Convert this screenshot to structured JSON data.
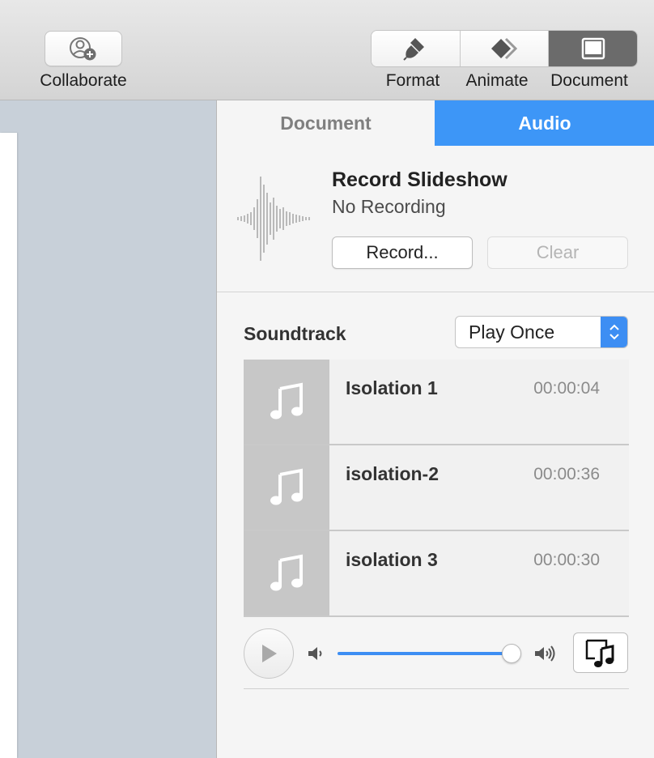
{
  "toolbar": {
    "collaborate_label": "Collaborate",
    "format_label": "Format",
    "animate_label": "Animate",
    "document_label": "Document",
    "active_segment": "Document"
  },
  "inspector": {
    "tabs": [
      {
        "label": "Document",
        "active": false
      },
      {
        "label": "Audio",
        "active": true
      }
    ],
    "record": {
      "title": "Record Slideshow",
      "status": "No Recording",
      "record_button": "Record...",
      "clear_button": "Clear"
    },
    "soundtrack": {
      "label": "Soundtrack",
      "mode_selected": "Play Once",
      "tracks": [
        {
          "name": "Isolation 1",
          "duration": "00:00:04"
        },
        {
          "name": "isolation-2",
          "duration": "00:00:36"
        },
        {
          "name": "isolation 3",
          "duration": "00:00:30"
        }
      ],
      "volume_level": 1.0
    }
  },
  "colors": {
    "accent": "#3d96f7",
    "toolbar_bg": "#dcdcdc",
    "canvas_bg": "#c8d0d9"
  },
  "icons": {
    "collaborate": "add-person-icon",
    "format": "paintbrush-icon",
    "animate": "diamond-icon",
    "document": "document-icon",
    "waveform": "waveform-icon",
    "track": "music-note-icon",
    "play": "play-icon",
    "volume_low": "volume-low-icon",
    "volume_high": "volume-high-icon",
    "media_browser": "media-browser-icon"
  }
}
